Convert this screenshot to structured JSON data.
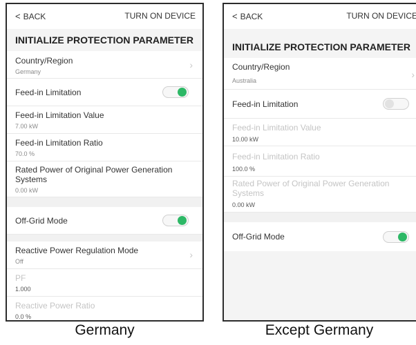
{
  "left": {
    "back_label": "BACK",
    "turn_on_label": "TURN ON DEVICE",
    "title": "INITIALIZE PROTECTION PARAMETER",
    "country": {
      "label": "Country/Region",
      "value": "Germany"
    },
    "feed_in": {
      "label": "Feed-in Limitation",
      "state": "on"
    },
    "feed_in_value": {
      "label": "Feed-in Limitation Value",
      "value": "7.00 kW"
    },
    "feed_in_ratio": {
      "label": "Feed-in Limitation Ratio",
      "value": "70.0 %"
    },
    "rated_power": {
      "label": "Rated Power of Original Power Generation Systems",
      "value": "0.00 kW"
    },
    "off_grid": {
      "label": "Off-Grid Mode",
      "state": "on"
    },
    "reactive_mode": {
      "label": "Reactive Power Regulation Mode",
      "value": "Off"
    },
    "pf": {
      "label": "PF",
      "value": "1.000"
    },
    "reactive_ratio": {
      "label": "Reactive Power Ratio",
      "value": "0.0 %"
    },
    "caption": "Germany"
  },
  "right": {
    "back_label": "BACK",
    "turn_on_label": "TURN ON DEVICE",
    "title": "INITIALIZE PROTECTION PARAMETER",
    "country": {
      "label": "Country/Region",
      "value": "Australia"
    },
    "feed_in": {
      "label": "Feed-in Limitation",
      "state": "off"
    },
    "feed_in_value": {
      "label": "Feed-in Limitation Value",
      "value": "10.00 kW"
    },
    "feed_in_ratio": {
      "label": "Feed-in Limitation Ratio",
      "value": "100.0 %"
    },
    "rated_power": {
      "label": "Rated Power of Original Power Generation Systems",
      "value": "0.00 kW"
    },
    "off_grid": {
      "label": "Off-Grid Mode",
      "state": "on"
    },
    "caption": "Except Germany"
  },
  "colors": {
    "toggle_on": "#2db866",
    "toggle_off": "#e2e2e2",
    "background": "#f4f4f4"
  }
}
